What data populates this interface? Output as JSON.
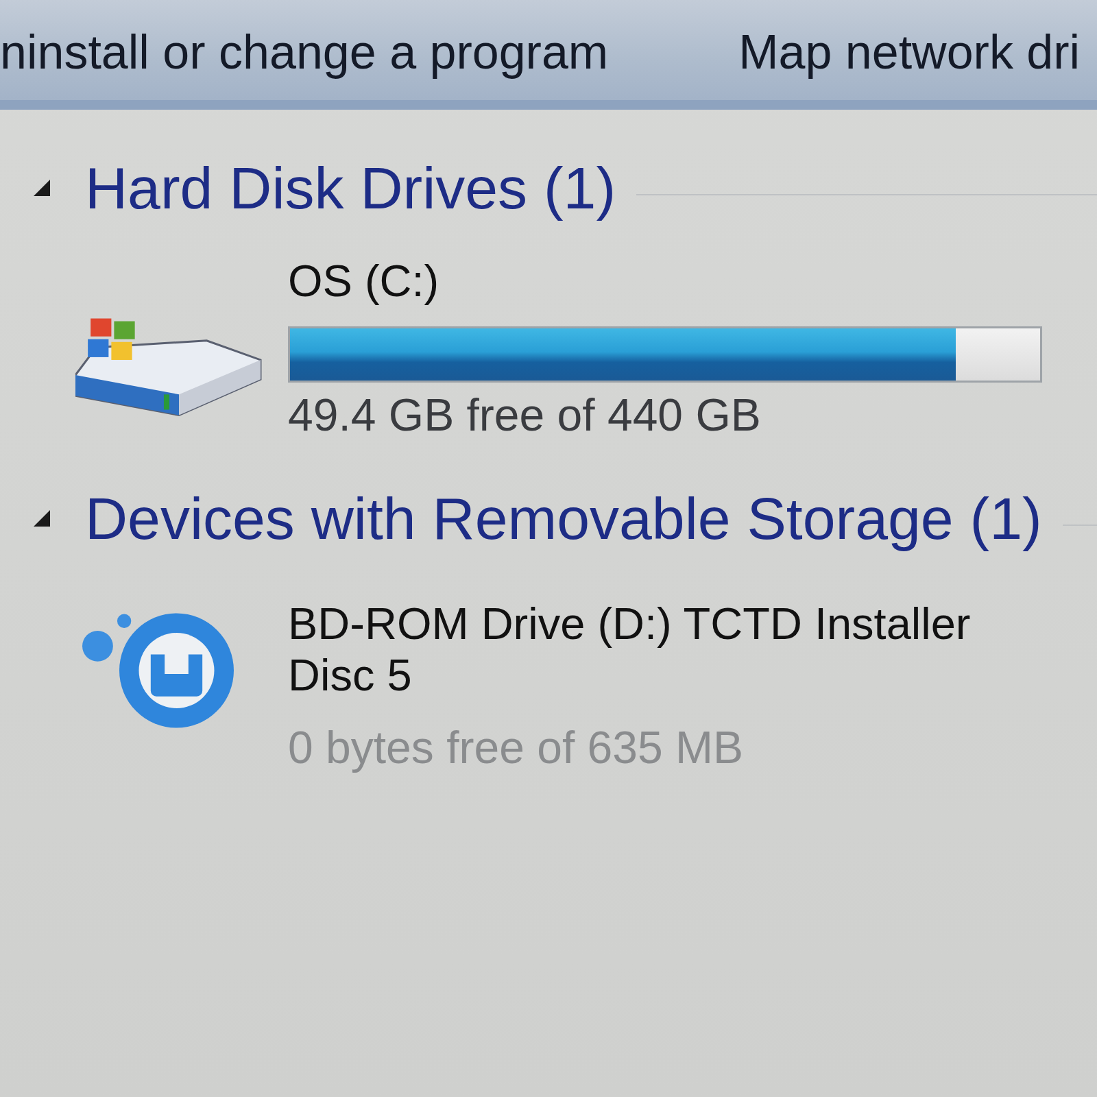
{
  "toolbar": {
    "buttons": [
      {
        "label": "ninstall or change a program"
      },
      {
        "label": "Map network dri"
      }
    ]
  },
  "groups": [
    {
      "title": "Hard Disk Drives (1)",
      "expanded": true,
      "items": [
        {
          "kind": "hard_disk",
          "name": "OS (C:)",
          "level": 0.888,
          "space": "49.4 GB free of 440 GB"
        }
      ]
    },
    {
      "title": "Devices with Removable Storage (1)",
      "expanded": true,
      "items": [
        {
          "kind": "optical",
          "name": "BD-ROM Drive (D:) TCTD Installer Disc 5",
          "space": "0 bytes free of 635 MB"
        }
      ]
    }
  ]
}
